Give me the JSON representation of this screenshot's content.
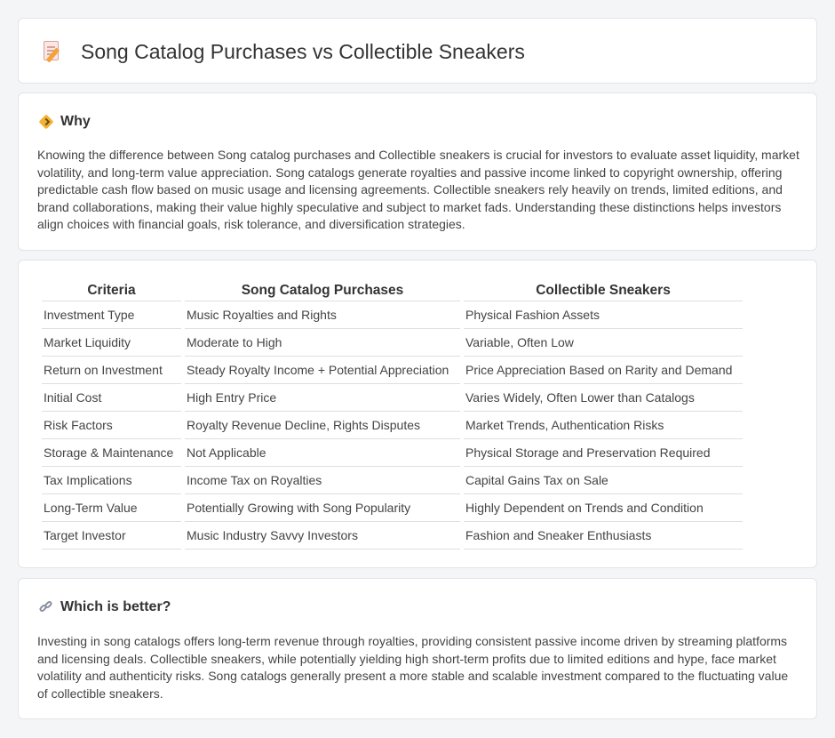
{
  "header": {
    "title": "Song Catalog Purchases vs Collectible Sneakers",
    "icon": "memo-pencil-icon"
  },
  "why": {
    "heading": "Why",
    "icon": "diamond-icon",
    "text": "Knowing the difference between Song catalog purchases and Collectible sneakers is crucial for investors to evaluate asset liquidity, market volatility, and long-term value appreciation. Song catalogs generate royalties and passive income linked to copyright ownership, offering predictable cash flow based on music usage and licensing agreements. Collectible sneakers rely heavily on trends, limited editions, and brand collaborations, making their value highly speculative and subject to market fads. Understanding these distinctions helps investors align choices with financial goals, risk tolerance, and diversification strategies."
  },
  "table": {
    "headers": [
      "Criteria",
      "Song Catalog Purchases",
      "Collectible Sneakers"
    ],
    "rows": [
      [
        "Investment Type",
        "Music Royalties and Rights",
        "Physical Fashion Assets"
      ],
      [
        "Market Liquidity",
        "Moderate to High",
        "Variable, Often Low"
      ],
      [
        "Return on Investment",
        "Steady Royalty Income + Potential Appreciation",
        "Price Appreciation Based on Rarity and Demand"
      ],
      [
        "Initial Cost",
        "High Entry Price",
        "Varies Widely, Often Lower than Catalogs"
      ],
      [
        "Risk Factors",
        "Royalty Revenue Decline, Rights Disputes",
        "Market Trends, Authentication Risks"
      ],
      [
        "Storage & Maintenance",
        "Not Applicable",
        "Physical Storage and Preservation Required"
      ],
      [
        "Tax Implications",
        "Income Tax on Royalties",
        "Capital Gains Tax on Sale"
      ],
      [
        "Long-Term Value",
        "Potentially Growing with Song Popularity",
        "Highly Dependent on Trends and Condition"
      ],
      [
        "Target Investor",
        "Music Industry Savvy Investors",
        "Fashion and Sneaker Enthusiasts"
      ]
    ]
  },
  "better": {
    "heading": "Which is better?",
    "icon": "link-icon",
    "text": "Investing in song catalogs offers long-term revenue through royalties, providing consistent passive income driven by streaming platforms and licensing deals. Collectible sneakers, while potentially yielding high short-term profits due to limited editions and hype, face market volatility and authenticity risks. Song catalogs generally present a more stable and scalable investment compared to the fluctuating value of collectible sneakers."
  }
}
